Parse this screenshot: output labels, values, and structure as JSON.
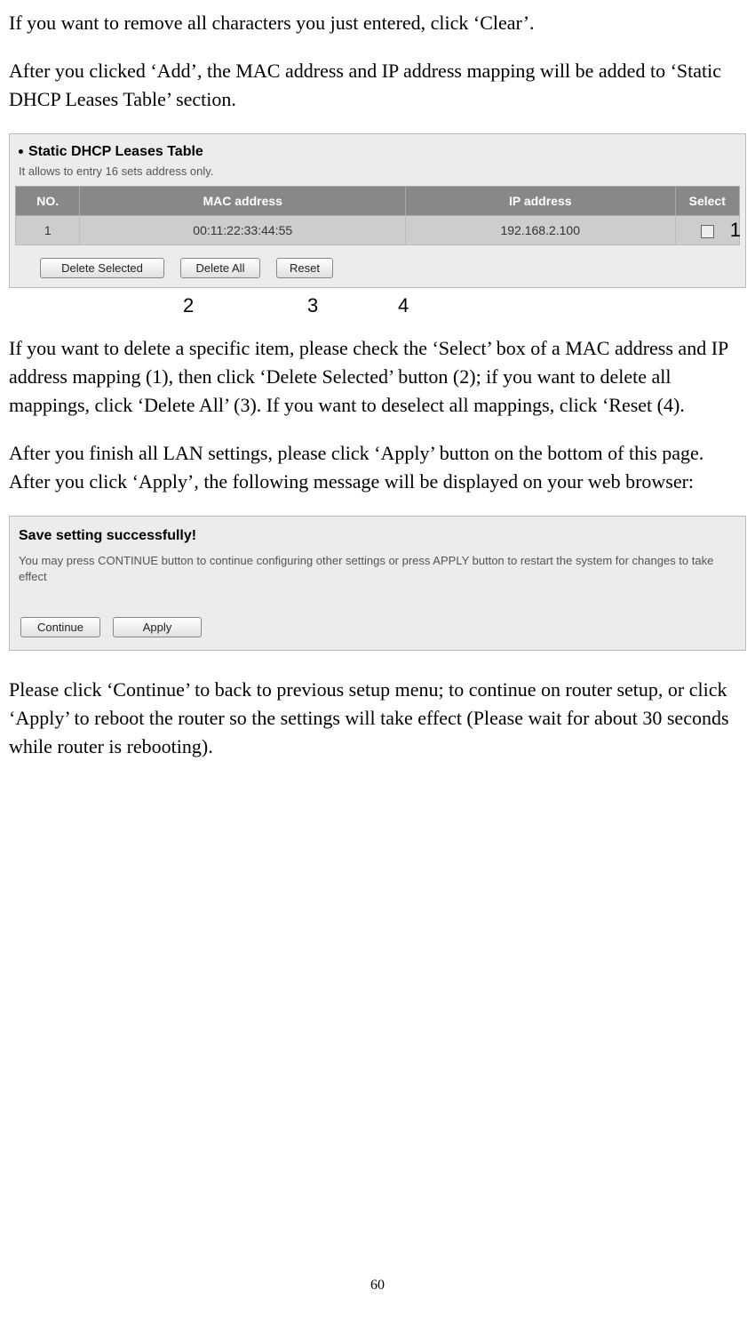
{
  "para1": "If you want to remove all characters you just entered, click ‘Clear’.",
  "para2": "After you clicked ‘Add’, the MAC address and IP address mapping will be added to ‘Static DHCP Leases Table’ section.",
  "panel1": {
    "title": "Static DHCP Leases Table",
    "sub": "It allows to entry 16 sets address only.",
    "headers": {
      "no": "NO.",
      "mac": "MAC address",
      "ip": "IP address",
      "sel": "Select"
    },
    "row": {
      "no": "1",
      "mac": "00:11:22:33:44:55",
      "ip": "192.168.2.100"
    },
    "buttons": {
      "delsel": "Delete Selected",
      "delall": "Delete All",
      "reset": "Reset"
    }
  },
  "callouts": {
    "c1": "1",
    "c2": "2",
    "c3": "3",
    "c4": "4"
  },
  "para3": "If you want to delete a specific item, please check the ‘Select’ box of a MAC address and IP address mapping (1), then click ‘Delete Selected’ button (2); if you want to delete all mappings, click ‘Delete All’ (3). If you want to deselect all mappings, click ‘Reset (4).",
  "para4": "After you finish all LAN settings, please click ‘Apply’ button on the bottom of this page. After you click ‘Apply’, the following message will be displayed on your web browser:",
  "panel2": {
    "title": "Save setting successfully!",
    "text": "You may press CONTINUE button to continue configuring other settings or press APPLY button to restart the system for changes to take effect",
    "buttons": {
      "cont": "Continue",
      "apply": "Apply"
    }
  },
  "para5": "Please click ‘Continue’ to back to previous setup menu; to continue on router setup, or click ‘Apply’ to reboot the router so the settings will take effect (Please wait for about 30 seconds while router is rebooting).",
  "pageNumber": "60"
}
